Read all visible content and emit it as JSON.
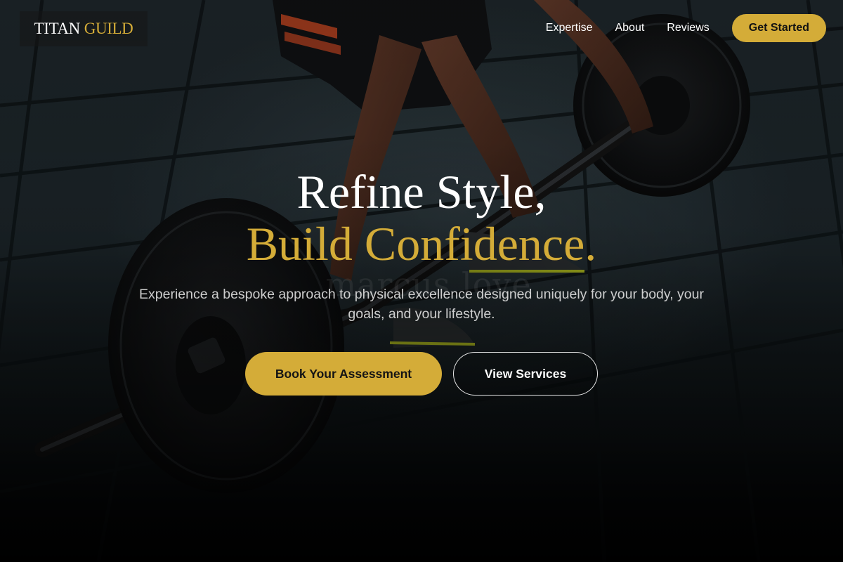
{
  "brand": {
    "name_primary": "TITAN",
    "name_accent": "GUILD",
    "accent_color": "#d4ac38"
  },
  "nav": {
    "links": [
      {
        "label": "Expertise"
      },
      {
        "label": "About"
      },
      {
        "label": "Reviews"
      }
    ],
    "cta_label": "Get Started"
  },
  "hero": {
    "headline_line1": "Refine Style,",
    "headline_line2": "Build Confidence.",
    "subtext": "Experience a bespoke approach to physical excellence designed uniquely for your body, your goals, and your lifestyle.",
    "primary_cta": "Book Your Assessment",
    "secondary_cta": "View Services",
    "background_image": "athlete gripping a loaded barbell on dark gym floor tiles"
  },
  "watermark": "marcus love"
}
